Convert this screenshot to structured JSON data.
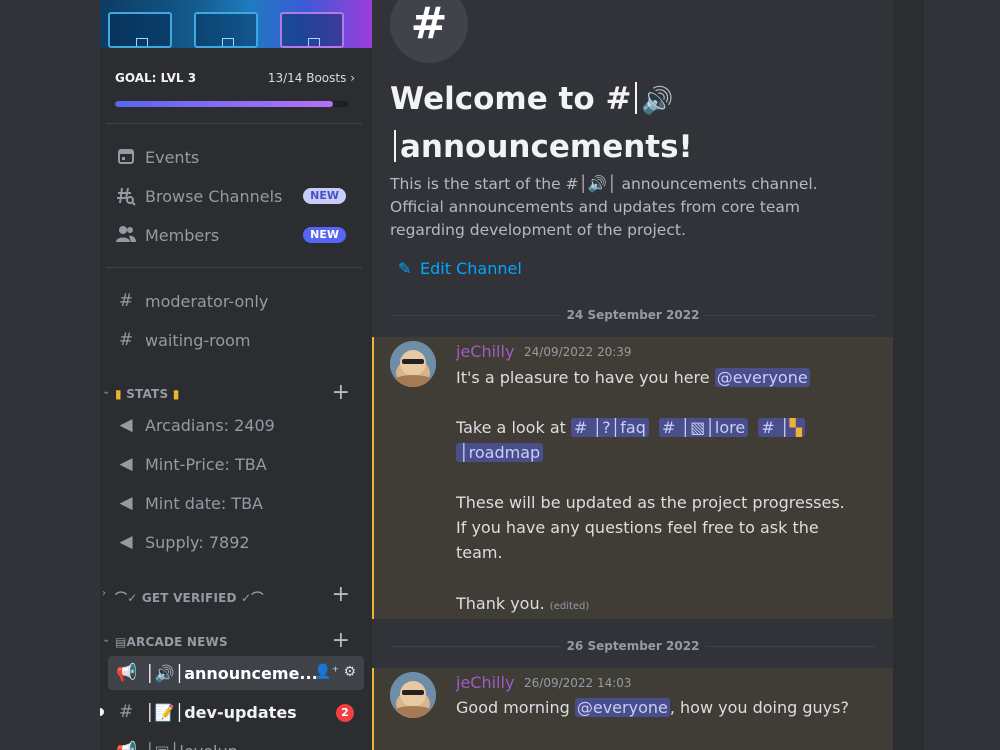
{
  "server": {
    "goal_title": "GOAL: LVL 3",
    "boosts": "13/14 Boosts",
    "boost_progress": 0.93
  },
  "nav": {
    "events": "Events",
    "browse_channels": "Browse Channels",
    "members": "Members",
    "new_badge": "NEW"
  },
  "channels_top": [
    "moderator-only",
    "waiting-room"
  ],
  "categories": {
    "stats": "STATS",
    "get_verified": "GET VERIFIED",
    "arcade_news": "ARCADE NEWS"
  },
  "stats_channels": [
    "Arcadians: 2409",
    "Mint-Price: TBA",
    "Mint date: TBA",
    "Supply: 7892"
  ],
  "news_channels": {
    "announcements": "announceme...",
    "dev_updates": "dev-updates",
    "dev_updates_unread": "2",
    "levelup": "levelup"
  },
  "main": {
    "welcome_line1": "Welcome to #",
    "welcome_line2": "announcements!",
    "intro_1": "This is the start of the #",
    "intro_2": "announcements channel.",
    "intro_3": "Official announcements and updates from core team",
    "intro_4": "regarding development of the project.",
    "edit_channel": "Edit Channel"
  },
  "dates": [
    "24 September 2022",
    "26 September 2022"
  ],
  "messages": [
    {
      "author": "jeChilly",
      "timestamp": "24/09/2022 20:39",
      "line1_pre": "It's a pleasure to have you here ",
      "mention": "@everyone",
      "look": "Take a look at ",
      "ch_faq": "faq",
      "ch_lore": "lore",
      "ch_roadmap": "roadmap",
      "line3": "These will be updated as the project progresses.",
      "line4": "If you have any questions feel free to ask the",
      "line5": "team.",
      "thanks": "Thank you.",
      "edited": "(edited)"
    },
    {
      "author": "jeChilly",
      "timestamp": "26/09/2022 14:03",
      "line1_pre": "Good morning ",
      "mention": "@everyone",
      "line1_post": ", how you doing guys?"
    }
  ],
  "colors": {
    "accent": "#5865f2",
    "link": "#00a8fc",
    "author": "#a05bc4",
    "highlight_border": "#f0b232"
  }
}
